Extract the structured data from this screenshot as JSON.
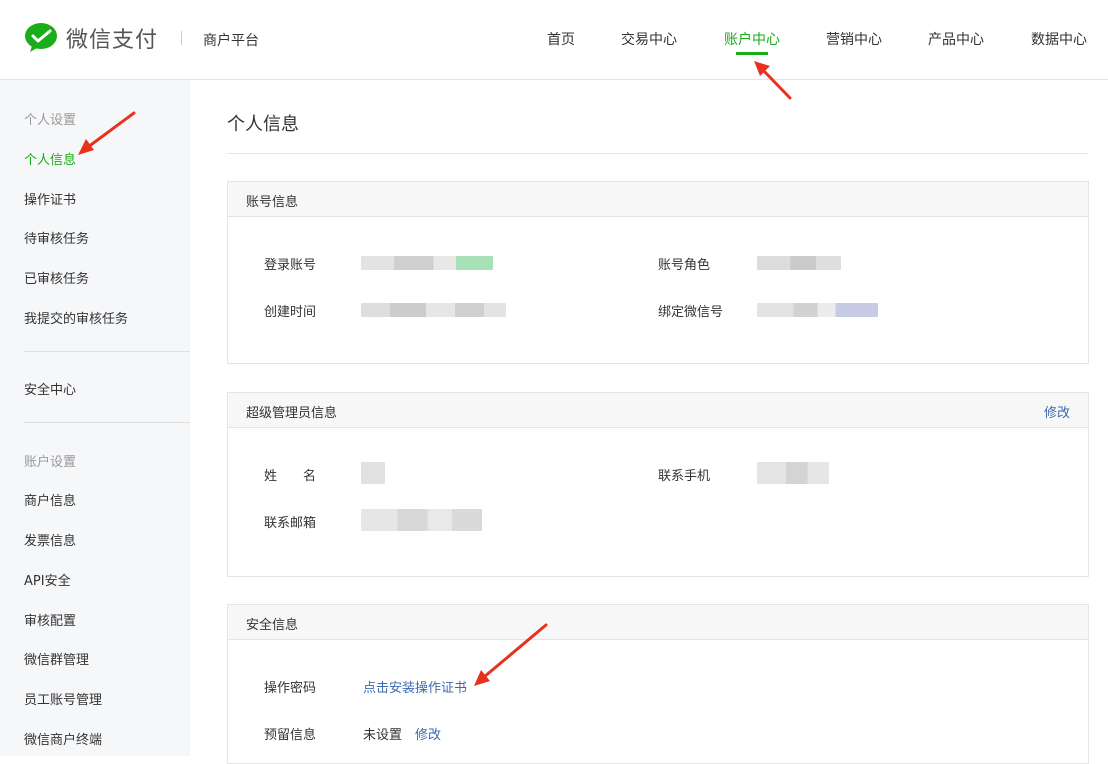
{
  "header": {
    "brand": "微信支付",
    "platform": "商户平台",
    "nav": [
      "首页",
      "交易中心",
      "账户中心",
      "营销中心",
      "产品中心",
      "数据中心"
    ],
    "active_nav": "账户中心",
    "brand_color": "#1aad19"
  },
  "sidebar": {
    "group1": "个人设置",
    "items1": [
      "个人信息",
      "操作证书",
      "待审核任务",
      "已审核任务",
      "我提交的审核任务"
    ],
    "security": "安全中心",
    "group2": "账户设置",
    "items2": [
      "商户信息",
      "发票信息",
      "API安全",
      "审核配置",
      "微信群管理",
      "员工账号管理",
      "微信商户终端"
    ]
  },
  "main": {
    "title": "个人信息",
    "account": {
      "title": "账号信息",
      "login_label": "登录账号",
      "role_label": "账号角色",
      "created_label": "创建时间",
      "wechat_label": "绑定微信号"
    },
    "admin": {
      "title": "超级管理员信息",
      "edit": "修改",
      "name_label": "姓　　名",
      "phone_label": "联系手机",
      "email_label": "联系邮箱"
    },
    "security": {
      "title": "安全信息",
      "password_label": "操作密码",
      "install_link": "点击安装操作证书",
      "reserved_label": "预留信息",
      "reserved_value": "未设置",
      "edit": "修改"
    }
  }
}
